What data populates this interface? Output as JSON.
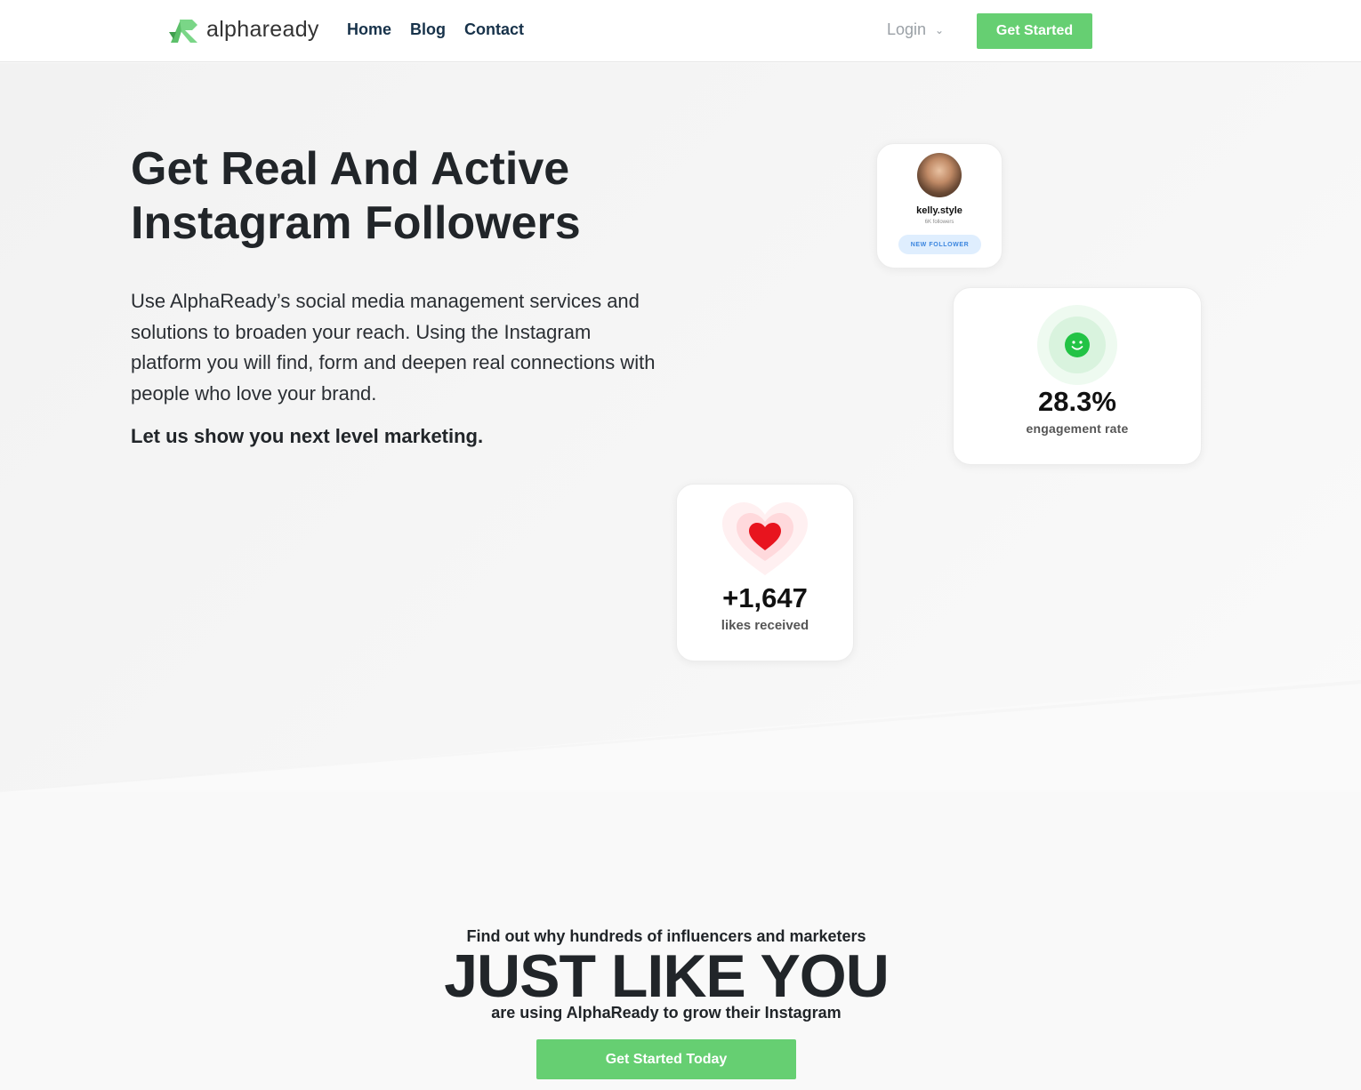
{
  "header": {
    "logo": {
      "prefix": "alpha",
      "suffix": "ready"
    },
    "nav": [
      "Home",
      "Blog",
      "Contact"
    ],
    "login_label": "Login",
    "cta_label": "Get Started"
  },
  "hero": {
    "title_line1": "Get Real And Active",
    "title_line2": "Instagram Followers",
    "description": "Use AlphaReady’s social media management services and solutions to broaden your reach. Using the Instagram platform you will find, form and deepen real connections with people who love your brand.",
    "tagline": "Let us show you next level marketing."
  },
  "cards": {
    "profile": {
      "name": "kelly.style",
      "followers": "6K followers",
      "badge": "NEW FOLLOWER"
    },
    "engagement": {
      "value": "28.3%",
      "label": "engagement rate"
    },
    "likes": {
      "value": "+1,647",
      "label": "likes received"
    }
  },
  "bottom": {
    "pre": "Find out why hundreds of influencers and marketers",
    "big": "JUST LIKE YOU",
    "post": "are using AlphaReady to grow their Instagram",
    "cta_label": "Get Started Today"
  },
  "colors": {
    "accent": "#66cf72",
    "nav_text": "#17324a",
    "heart": "#e8141e",
    "smile": "#22c345"
  },
  "icons": [
    "alphaready-logo-icon",
    "chevron-down-icon",
    "smile-icon",
    "heart-icon"
  ]
}
